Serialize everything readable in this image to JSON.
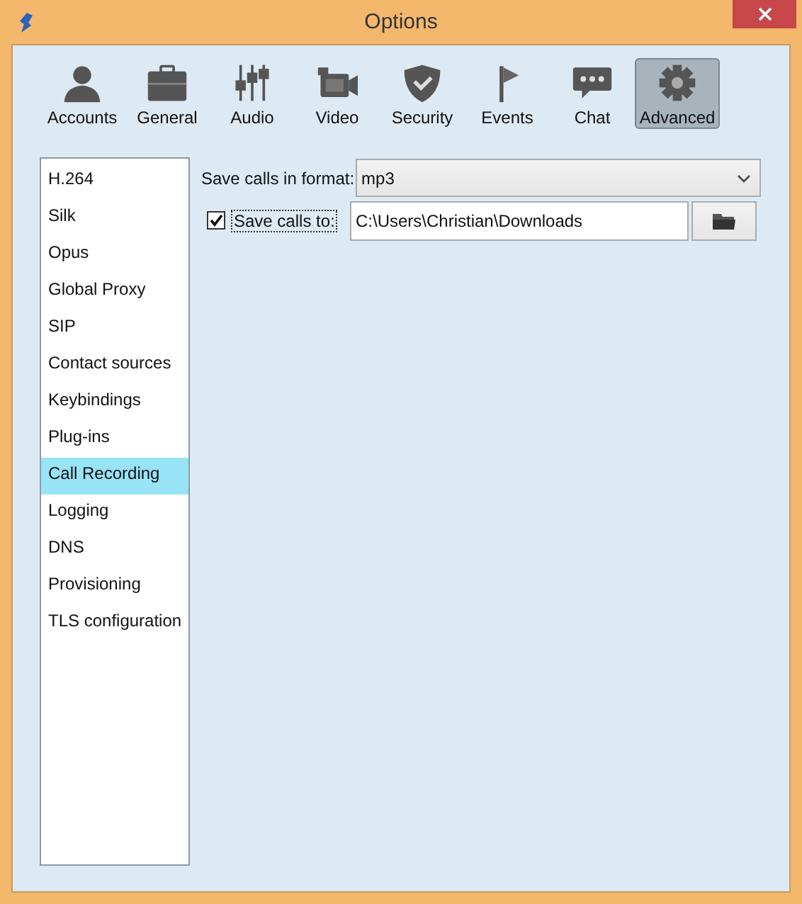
{
  "window": {
    "title": "Options"
  },
  "toolbar": [
    {
      "label": "Accounts",
      "selected": false
    },
    {
      "label": "General",
      "selected": false
    },
    {
      "label": "Audio",
      "selected": false
    },
    {
      "label": "Video",
      "selected": false
    },
    {
      "label": "Security",
      "selected": false
    },
    {
      "label": "Events",
      "selected": false
    },
    {
      "label": "Chat",
      "selected": false
    },
    {
      "label": "Advanced",
      "selected": true
    }
  ],
  "sidebar": {
    "items": [
      {
        "label": "H.264",
        "selected": false
      },
      {
        "label": "Silk",
        "selected": false
      },
      {
        "label": "Opus",
        "selected": false
      },
      {
        "label": "Global Proxy",
        "selected": false
      },
      {
        "label": "SIP",
        "selected": false
      },
      {
        "label": "Contact sources",
        "selected": false
      },
      {
        "label": "Keybindings",
        "selected": false
      },
      {
        "label": "Plug-ins",
        "selected": false
      },
      {
        "label": "Call Recording",
        "selected": true
      },
      {
        "label": "Logging",
        "selected": false
      },
      {
        "label": "DNS",
        "selected": false
      },
      {
        "label": "Provisioning",
        "selected": false
      },
      {
        "label": "TLS configuration",
        "selected": false
      }
    ]
  },
  "format": {
    "label": "Save calls in format:",
    "value": "mp3"
  },
  "save_to": {
    "label": "Save calls to:",
    "checked": true,
    "value": "C:\\Users\\Christian\\Downloads"
  }
}
